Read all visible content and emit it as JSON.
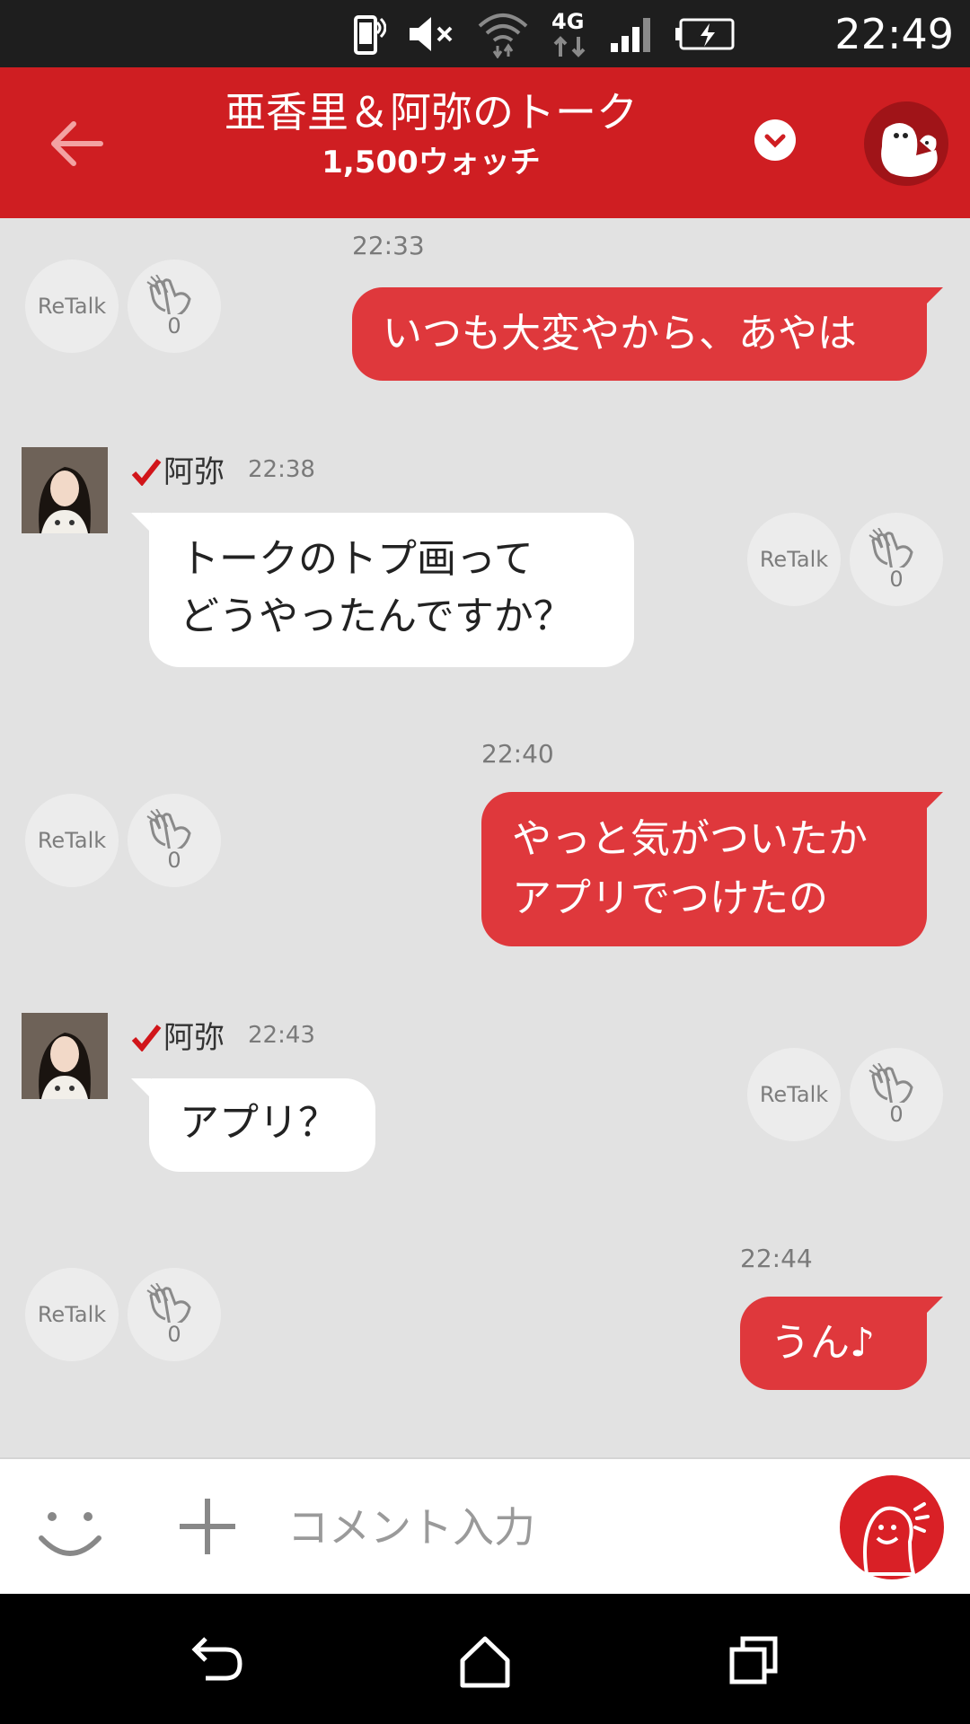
{
  "status_bar": {
    "time": "22:49",
    "network": "4G",
    "icons": [
      "vibrate-icon",
      "mute-icon",
      "wifi-icon",
      "4g-icon",
      "signal-icon",
      "battery-charging-icon"
    ]
  },
  "header": {
    "title": "亜香里＆阿弥のトーク",
    "watch_count": "1,500ウォッチ",
    "back_icon": "back-arrow-icon",
    "dropdown_icon": "chevron-down-icon",
    "avatar_icon": "ghost-mascot-icon"
  },
  "retalk_label": "ReTalk",
  "messages": [
    {
      "kind": "out",
      "time": "22:33",
      "lines": [
        "いつも大変やから、あやは"
      ],
      "clap_count": "0"
    },
    {
      "kind": "in",
      "sender": "阿弥",
      "time": "22:38",
      "lines": [
        "トークのトプ画って",
        "どうやったんですか？"
      ],
      "clap_count": "0"
    },
    {
      "kind": "out",
      "time": "22:40",
      "lines": [
        "やっと気がついたか",
        "アプリでつけたの"
      ],
      "clap_count": "0"
    },
    {
      "kind": "in",
      "sender": "阿弥",
      "time": "22:43",
      "lines": [
        "アプリ？"
      ],
      "clap_count": "0"
    },
    {
      "kind": "out",
      "time": "22:44",
      "lines": [
        "うん♪"
      ],
      "clap_count": "0"
    }
  ],
  "input_bar": {
    "placeholder": "コメント入力",
    "emoji_icon": "smiley-icon",
    "plus_icon": "plus-icon",
    "send_icon": "shout-mascot-icon"
  },
  "nav_bar": {
    "icons": [
      "back-nav-icon",
      "home-icon",
      "recents-icon"
    ]
  },
  "colors": {
    "accent": "#cf1e22",
    "bubble_out": "#df383c",
    "chat_bg": "#e2e2e2"
  }
}
